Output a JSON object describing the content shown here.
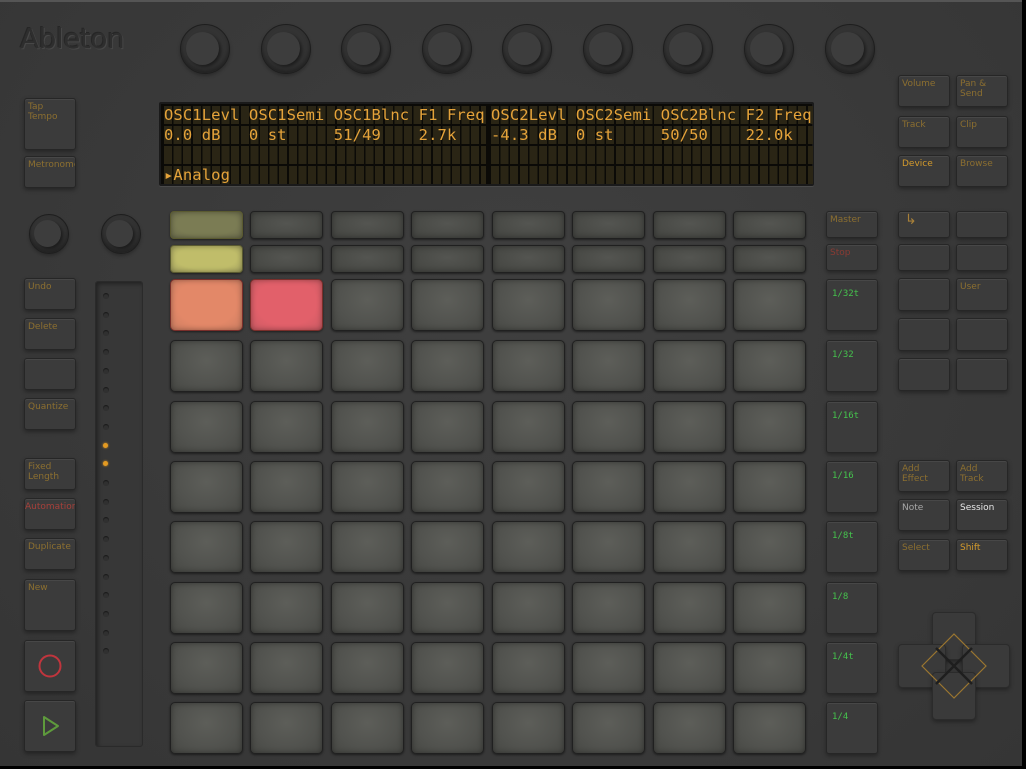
{
  "brand": {
    "logo": "Ableton"
  },
  "encoders": {
    "count": 9,
    "left_knobs": 2
  },
  "display": {
    "left": {
      "row1": "OSC1Levl OSC1Semi OSC1Blnc F1 Freq",
      "row2": "0.0 dB   0 st     51/49    2.7k",
      "row3": "",
      "row4": "▸Analog"
    },
    "right": {
      "row1": "OSC2Levl OSC2Semi OSC2Blnc F2 Freq",
      "row2": "-4.3 dB  0 st     50/50    22.0k",
      "row3": "",
      "row4": ""
    }
  },
  "left_buttons": [
    {
      "id": "tap-tempo",
      "label": "Tap\nTempo",
      "style": ""
    },
    {
      "id": "metronome",
      "label": "Metronome",
      "style": ""
    },
    {
      "id": "undo",
      "label": "Undo",
      "style": ""
    },
    {
      "id": "delete",
      "label": "Delete",
      "style": ""
    },
    {
      "id": "blank",
      "label": "",
      "style": ""
    },
    {
      "id": "quantize",
      "label": "Quantize",
      "style": ""
    },
    {
      "id": "fixed-length",
      "label": "Fixed\nLength",
      "style": ""
    },
    {
      "id": "automation",
      "label": "Automation",
      "style": "redtxt"
    },
    {
      "id": "duplicate",
      "label": "Duplicate",
      "style": ""
    },
    {
      "id": "new",
      "label": "New",
      "style": ""
    }
  ],
  "transport": {
    "record_icon": "record-circle-icon",
    "play_icon": "play-triangle-icon",
    "record_color": "#c0353d",
    "play_color": "#5e9a3c"
  },
  "touch_strip": {
    "lit_leds": [
      8,
      9
    ],
    "led_count": 20,
    "led_color": "#e39a22"
  },
  "scene_rows": {
    "row1": [
      "#7b7c54",
      "",
      "",
      "",
      "",
      "",
      "",
      ""
    ],
    "row2": [
      "#c0bd6a",
      "",
      "",
      "",
      "",
      "",
      "",
      ""
    ]
  },
  "pads": {
    "rows": 8,
    "cols": 8,
    "lit": [
      {
        "row": 0,
        "col": 0,
        "color": "#e38868"
      },
      {
        "row": 0,
        "col": 1,
        "color": "#e2606a"
      }
    ]
  },
  "scene_buttons": {
    "master": "Master",
    "stop": "Stop",
    "rates": [
      "1/32t",
      "1/32",
      "1/16t",
      "1/16",
      "1/8t",
      "1/8",
      "1/4t",
      "1/4"
    ]
  },
  "mode_buttons": [
    {
      "id": "volume",
      "label": "Volume",
      "style": ""
    },
    {
      "id": "pan-send",
      "label": "Pan &\nSend",
      "style": ""
    },
    {
      "id": "track",
      "label": "Track",
      "style": ""
    },
    {
      "id": "clip",
      "label": "Clip",
      "style": ""
    },
    {
      "id": "device",
      "label": "Device",
      "style": "orange"
    },
    {
      "id": "browse",
      "label": "Browse",
      "style": ""
    }
  ],
  "right_grid": [
    {
      "id": "return",
      "label": "↳",
      "style": ""
    },
    {
      "id": "blank-1",
      "label": "",
      "style": ""
    },
    {
      "id": "blank-2",
      "label": "",
      "style": ""
    },
    {
      "id": "blank-3",
      "label": "",
      "style": ""
    },
    {
      "id": "blank-4",
      "label": "",
      "style": ""
    },
    {
      "id": "user",
      "label": "User",
      "style": ""
    },
    {
      "id": "blank-5",
      "label": "",
      "style": ""
    },
    {
      "id": "blank-6",
      "label": "",
      "style": ""
    },
    {
      "id": "blank-7",
      "label": "",
      "style": ""
    },
    {
      "id": "blank-8",
      "label": "",
      "style": ""
    }
  ],
  "bottom_right": [
    {
      "id": "add-effect",
      "label": "Add\nEffect",
      "style": ""
    },
    {
      "id": "add-track",
      "label": "Add\nTrack",
      "style": ""
    },
    {
      "id": "note",
      "label": "Note",
      "style": "grey"
    },
    {
      "id": "session",
      "label": "Session",
      "style": "white"
    },
    {
      "id": "select",
      "label": "Select",
      "style": ""
    },
    {
      "id": "shift",
      "label": "Shift",
      "style": "orange"
    }
  ],
  "dpad": {
    "icon": "diamond-arrows-icon",
    "color": "#9b7630"
  }
}
